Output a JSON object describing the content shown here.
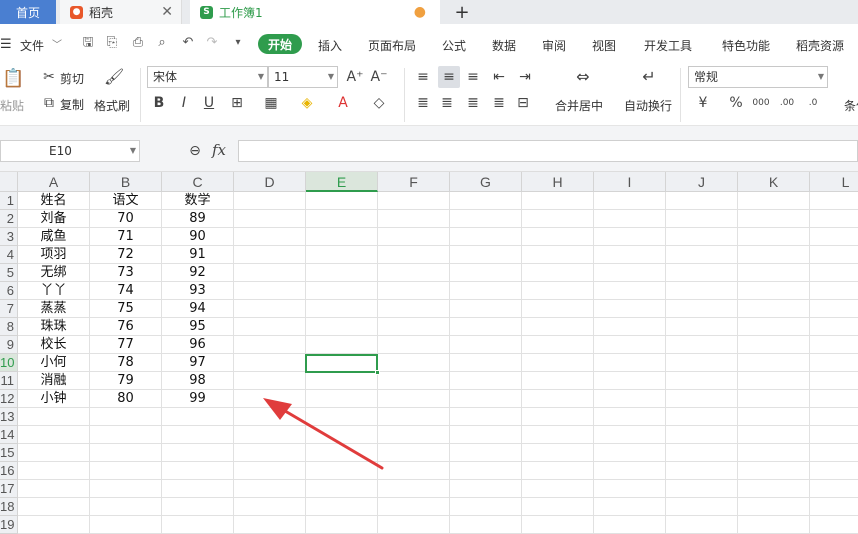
{
  "tabs": {
    "home": "首页",
    "daoke": "稻壳",
    "book": "工作簿1",
    "new_tab": "+"
  },
  "menu": {
    "file": "文件",
    "items": [
      "开始",
      "插入",
      "页面布局",
      "公式",
      "数据",
      "审阅",
      "视图",
      "开发工具",
      "特色功能",
      "稻壳资源"
    ]
  },
  "ribbon": {
    "paste": "粘贴",
    "cut": "剪切",
    "copy": "复制",
    "format_painter": "格式刷",
    "font_name": "宋体",
    "font_size": "11",
    "merge_center": "合并居中",
    "wrap_text": "自动换行",
    "number_format": "常规",
    "conditional": "条件"
  },
  "formula_bar": {
    "cell_ref": "E10",
    "fx": "fx",
    "value": ""
  },
  "columns": [
    "A",
    "B",
    "C",
    "D",
    "E",
    "F",
    "G",
    "H",
    "I",
    "J",
    "K",
    "L"
  ],
  "selected_column": "E",
  "selected_row": 10,
  "rows": [
    1,
    2,
    3,
    4,
    5,
    6,
    7,
    8,
    9,
    10,
    11,
    12,
    13,
    14,
    15,
    16,
    17,
    18,
    19
  ],
  "table": {
    "headers": [
      "姓名",
      "语文",
      "数学"
    ],
    "data": [
      [
        "刘备",
        "70",
        "89"
      ],
      [
        "咸鱼",
        "71",
        "90"
      ],
      [
        "项羽",
        "72",
        "91"
      ],
      [
        "无绑",
        "73",
        "92"
      ],
      [
        "丫丫",
        "74",
        "93"
      ],
      [
        "蒸蒸",
        "75",
        "94"
      ],
      [
        "珠珠",
        "76",
        "95"
      ],
      [
        "校长",
        "77",
        "96"
      ],
      [
        "小何",
        "78",
        "97"
      ],
      [
        "消融",
        "79",
        "98"
      ],
      [
        "小钟",
        "80",
        "99"
      ]
    ]
  },
  "colors": {
    "accent_green": "#2f9c4d",
    "tab_blue": "#4a7fd1",
    "arrow_red": "#e03c3c"
  }
}
